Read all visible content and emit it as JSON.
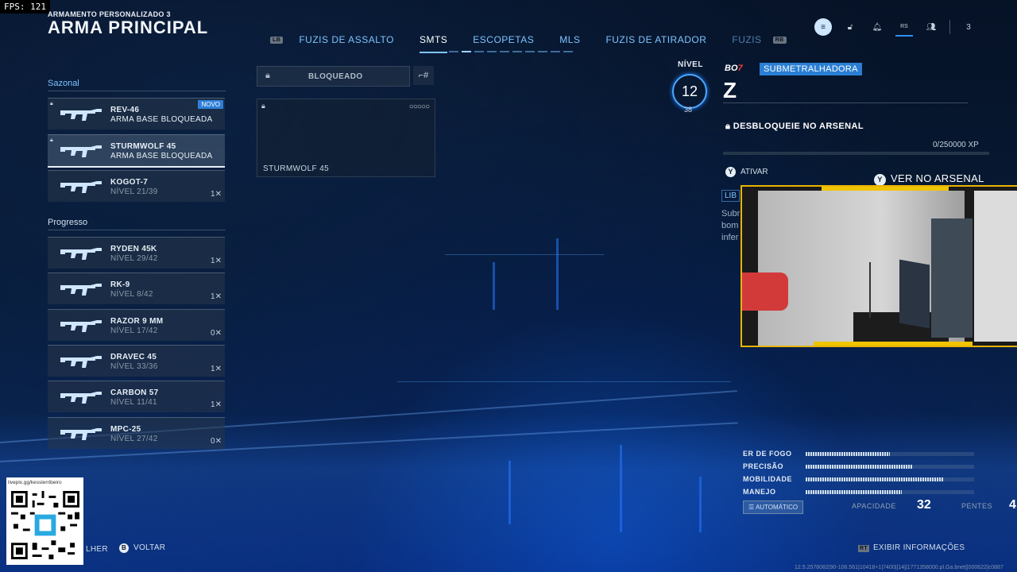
{
  "overlay": {
    "fps": "FPS: 121"
  },
  "header": {
    "subtitle": "ARMAMENTO PERSONALIZADO 3",
    "title": "ARMA PRINCIPAL",
    "lb_hint": "LB",
    "rb_hint": "RB",
    "tabs": [
      "FUZIS DE ASSALTO",
      "SMTS",
      "ESCOPETAS",
      "MLS",
      "FUZIS DE ATIRADOR",
      "FUZIS"
    ],
    "active_tab": 1,
    "page_count": 10,
    "active_page": 1
  },
  "topbar": {
    "rs_label": "RS",
    "player_count": "3"
  },
  "sections": {
    "seasonal": "Sazonal",
    "progress": "Progresso"
  },
  "seasonal": [
    {
      "name": "REV-46",
      "sub": "ARMA BASE BLOQUEADA",
      "badge": "NOVO",
      "count": ""
    },
    {
      "name": "STURMWOLF 45",
      "sub": "ARMA BASE BLOQUEADA",
      "badge": "",
      "count": ""
    },
    {
      "name": "KOGOT-7",
      "sub": "NÍVEL 21/39",
      "badge": "",
      "count": "1"
    }
  ],
  "progress": [
    {
      "name": "RYDEN 45K",
      "sub": "NÍVEL 29/42",
      "count": "1"
    },
    {
      "name": "RK-9",
      "sub": "NÍVEL 8/42",
      "count": "1"
    },
    {
      "name": "RAZOR 9 MM",
      "sub": "NÍVEL 17/42",
      "count": "0"
    },
    {
      "name": "DRAVEC 45",
      "sub": "NÍVEL 33/36",
      "count": "1"
    },
    {
      "name": "CARBON 57",
      "sub": "NÍVEL 11/41",
      "count": "1"
    },
    {
      "name": "MPC-25",
      "sub": "NÍVEL 27/42",
      "count": "0"
    }
  ],
  "blueprint": {
    "locked_label": "BLOQUEADO",
    "slot_name": "STURMWOLF 45",
    "slot_rating": "○○○○○"
  },
  "weapon": {
    "level_label": "NÍVEL",
    "level": "12",
    "level_max": "38",
    "game_badge": "BO",
    "game_badge_num": "7",
    "class_tag": "SUBMETRALHADORA",
    "letter": "Z",
    "unlock_text": "DESBLOQUEIE NO ARSENAL",
    "xp": "0/250000 XP",
    "activate_label": "ATIVAR",
    "arsenal_label": "VER NO ARSENAL",
    "lib_tag": "LIB",
    "desc_lines": [
      "Subr",
      "bom",
      "infer"
    ]
  },
  "stats": {
    "rows": [
      {
        "label": "ER DE FOGO",
        "value": 0.5
      },
      {
        "label": "PRECISÃO",
        "value": 0.63
      },
      {
        "label": "MOBILIDADE",
        "value": 0.82
      },
      {
        "label": "MANEJO",
        "value": 0.57
      }
    ],
    "mode": "AUTOMÁTICO",
    "capacity_label": "APACIDADE",
    "capacity_value": "32",
    "pentes_label": "PENTES",
    "pentes_value": "4"
  },
  "stream": {
    "qr_url": "livepix.gg/kesslerribeiro"
  },
  "bottom": {
    "left_action": "LHER",
    "back_label": "VOLTAR",
    "info_label": "EXIBIR INFORMAÇÕES",
    "rt_hint": "RT",
    "footer": "12.5.2576082|90-106.561|10418+1|7400||14||1771358000.pl.Ga.bnet||000622|c0887"
  }
}
